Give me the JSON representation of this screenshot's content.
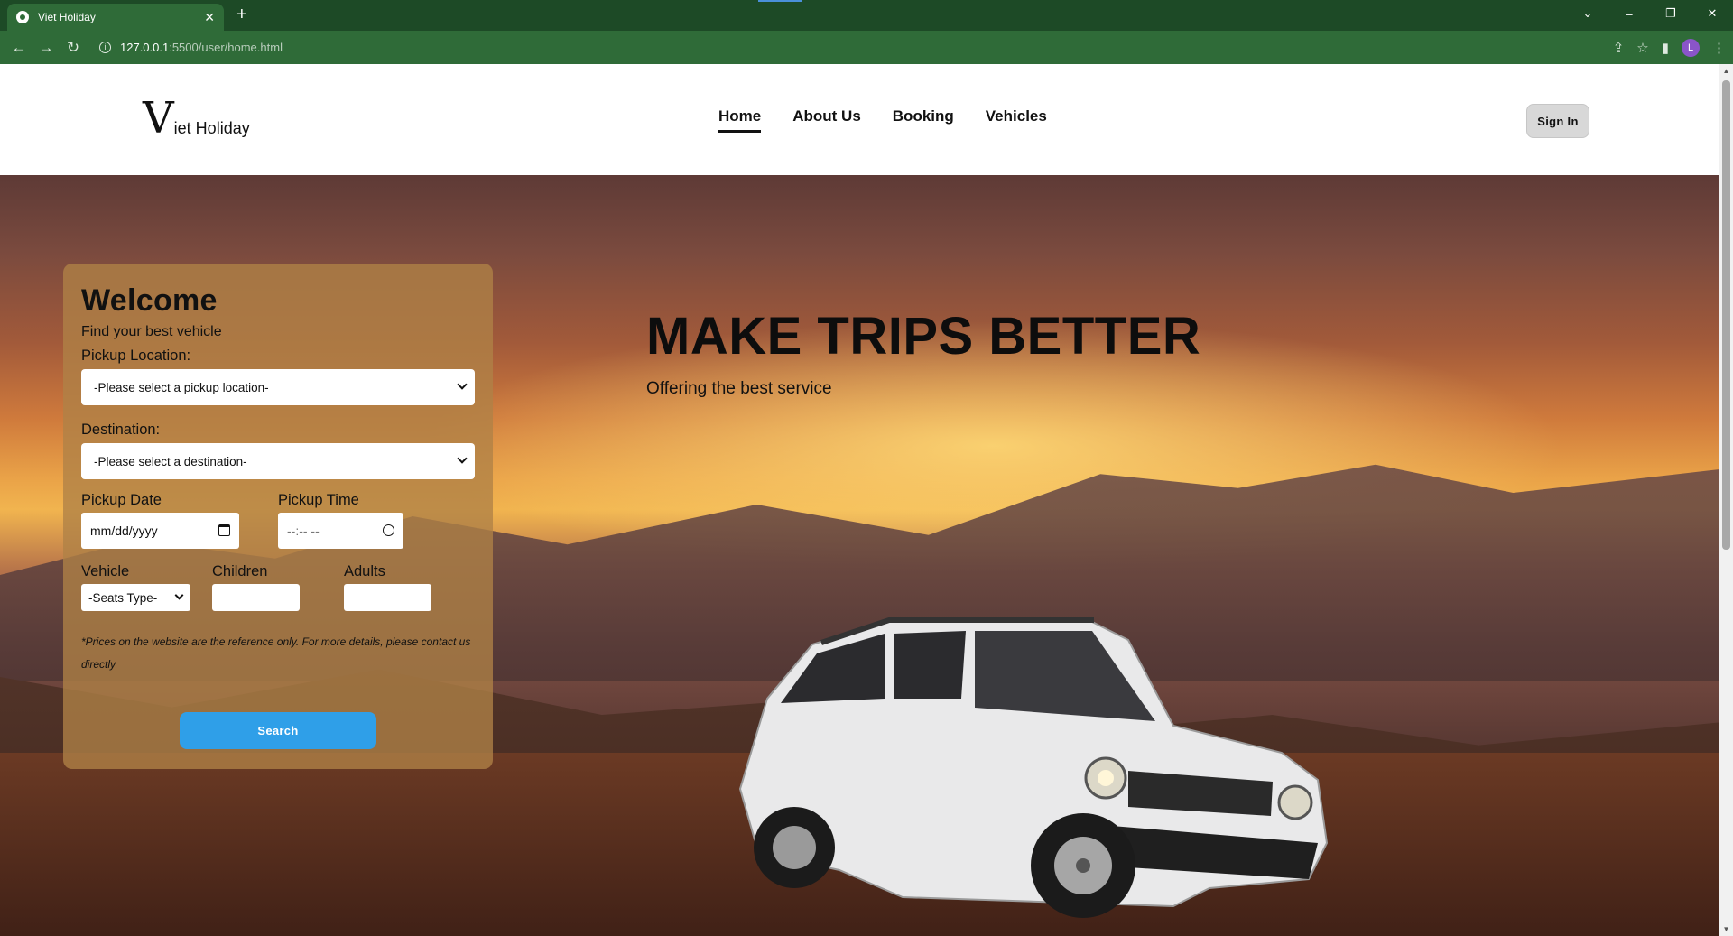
{
  "browser": {
    "tab_title": "Viet Holiday",
    "tab_close": "✕",
    "new_tab": "+",
    "url_host": "127.0.0.1",
    "url_path": ":5500/user/home.html",
    "profile_initial": "L",
    "window_controls": [
      "⌄",
      "–",
      "❐",
      "✕"
    ],
    "accent_color": "#2f6b38"
  },
  "header": {
    "logo_mark": "V",
    "logo_text": "iet Holiday",
    "nav": [
      "Home",
      "About Us",
      "Booking",
      "Vehicles"
    ],
    "active_nav": "Home",
    "signin_label": "Sign In"
  },
  "hero": {
    "title": "MAKE TRIPS BETTER",
    "subtitle": "Offering the best service"
  },
  "search_form": {
    "title": "Welcome",
    "subtitle": "Find your best vehicle",
    "pickup_location_label": "Pickup Location:",
    "pickup_location_value": "-Please select a pickup location-",
    "destination_label": "Destination:",
    "destination_value": "-Please select a destination-",
    "pickup_date_label": "Pickup Date",
    "pickup_date_placeholder": "mm/dd/yyyy",
    "pickup_time_label": "Pickup Time",
    "pickup_time_placeholder": "--:-- --",
    "vehicle_label": "Vehicle",
    "vehicle_value": "-Seats Type-",
    "children_label": "Children",
    "adults_label": "Adults",
    "note": "*Prices on the website are the reference only. For more details, please contact us directly",
    "search_label": "Search",
    "button_color": "#2f9fe8"
  }
}
